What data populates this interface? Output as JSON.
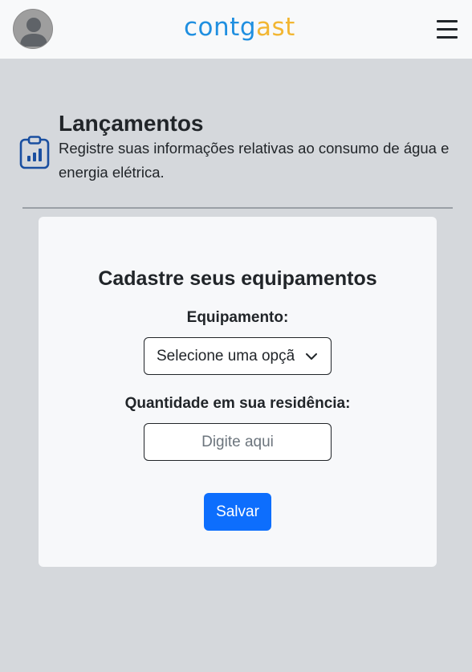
{
  "navbar": {
    "logo": {
      "part1": "cont",
      "drop": "g",
      "part2": "ast"
    },
    "avatar_icon": "user-avatar-icon",
    "menu_icon": "hamburger-menu-icon"
  },
  "header": {
    "icon": "clipboard-chart-icon",
    "title": "Lançamentos",
    "description": "Registre suas informações relativas ao consumo de água e energia elétrica."
  },
  "form": {
    "title": "Cadastre seus equipamentos",
    "equipment_label": "Equipamento:",
    "equipment_select_value": "Selecione uma opção",
    "quantity_label": "Quantidade em sua residência:",
    "quantity_placeholder": "Digite aqui",
    "save_label": "Salvar"
  },
  "colors": {
    "brand_blue": "#1f8fe0",
    "brand_yellow": "#f2b632",
    "primary_button": "#0d6efd",
    "page_bg": "#d5d8dc"
  }
}
